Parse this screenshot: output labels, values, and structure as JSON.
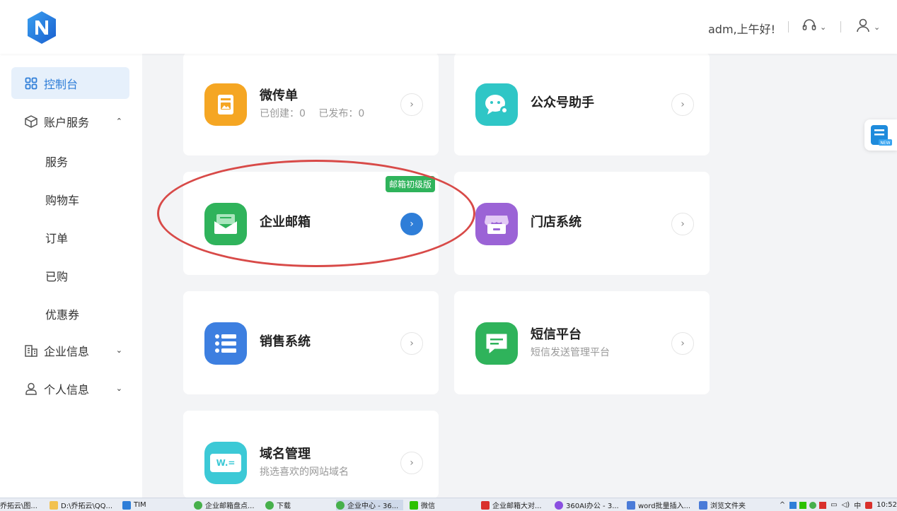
{
  "header": {
    "greeting": "adm,上午好!"
  },
  "sidebar": {
    "console": "控制台",
    "account_services": "账户服务",
    "sub_items": [
      "服务",
      "购物车",
      "订单",
      "已购",
      "优惠券"
    ],
    "enterprise_info": "企业信息",
    "personal_info": "个人信息"
  },
  "cards": {
    "flyer": {
      "title": "微传单",
      "created": "已创建：0",
      "published": "已发布：0",
      "color": "#f5a623"
    },
    "wechat_assistant": {
      "title": "公众号助手",
      "color": "#2fc6c6"
    },
    "enterprise_mail": {
      "title": "企业邮箱",
      "badge": "邮箱初级版",
      "color": "#2fb35b"
    },
    "store_system": {
      "title": "门店系统",
      "color": "#9b63d6"
    },
    "sales_system": {
      "title": "销售系统",
      "color": "#3d7fe0"
    },
    "sms_platform": {
      "title": "短信平台",
      "subtitle": "短信发送管理平台",
      "color": "#2fb35b"
    },
    "domain_mgmt": {
      "title": "域名管理",
      "subtitle": "挑选喜欢的网站域名",
      "icon_text": "W.=",
      "color": "#3cc9d6"
    }
  },
  "taskbar": {
    "items": [
      "乔拓云\\图...",
      "D:\\乔拓云\\QQ...",
      "TIM",
      "企业邮箱盘点...",
      "下载",
      "企业中心 - 36...",
      "微信",
      "企业邮箱大对...",
      "360AI办公 - 3...",
      "word批量插入...",
      "浏览文件夹"
    ],
    "ime": "中",
    "time": "10:52"
  },
  "float": {
    "badge": "NEW"
  }
}
